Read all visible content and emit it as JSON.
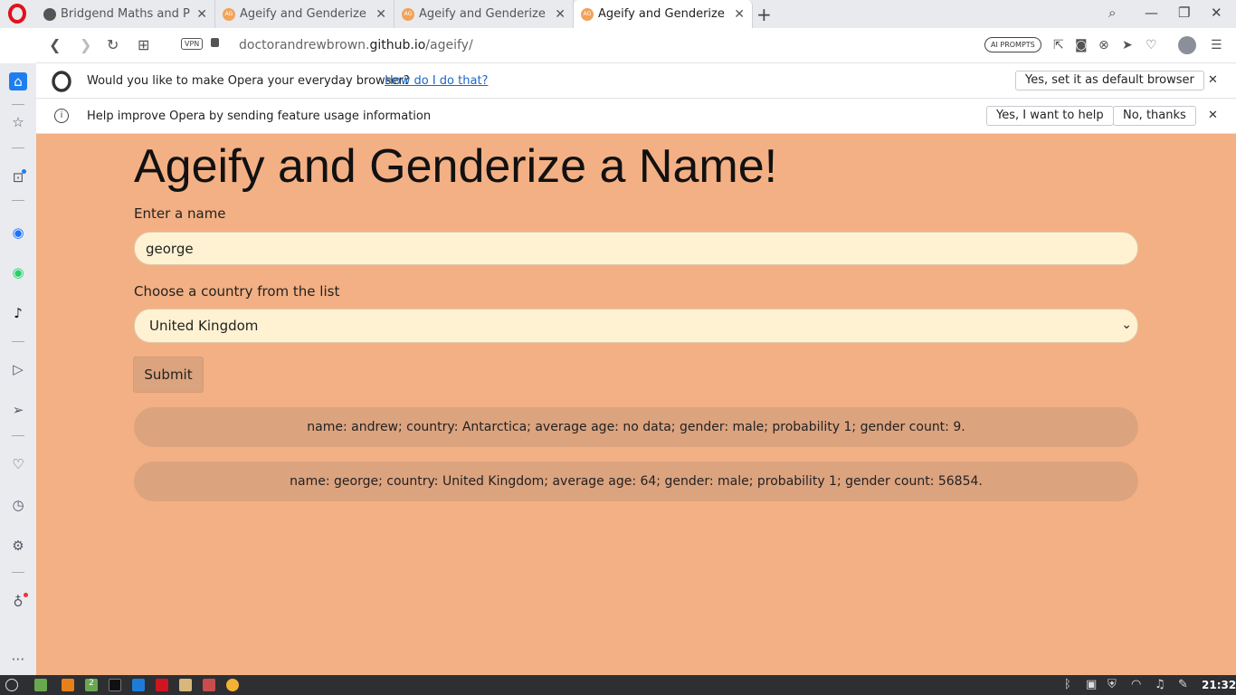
{
  "tabs": [
    {
      "title": "Bridgend Maths and Phy",
      "favicon": "github-icon"
    },
    {
      "title": "Ageify and Genderize a N",
      "favicon": "ag-icon"
    },
    {
      "title": "Ageify and Genderize a N",
      "favicon": "ag-icon"
    },
    {
      "title": "Ageify and Genderize a N",
      "favicon": "ag-icon",
      "active": true
    }
  ],
  "favicon_text": "AG",
  "address": {
    "url_host": "doctorandrewbrown.",
    "url_domain": "github.io",
    "url_path": "/ageify/",
    "vpn_label": "VPN",
    "ai_prompts_label": "AI PROMPTS"
  },
  "infobar_default": {
    "message": "Would you like to make Opera your everyday browser?",
    "link": "How do I do that?",
    "button": "Yes, set it as default browser"
  },
  "infobar_usage": {
    "message": "Help improve Opera by sending feature usage information",
    "accept": "Yes, I want to help",
    "decline": "No, thanks"
  },
  "page": {
    "heading": "Ageify and Genderize a Name!",
    "name_label": "Enter a name",
    "name_value": "george",
    "country_label": "Choose a country from the list",
    "country_value": "United Kingdom",
    "submit_label": "Submit",
    "results": [
      "name: andrew; country: Antarctica; average age: no data; gender: male; probability 1; gender count: 9.",
      "name: george; country: United Kingdom; average age: 64; gender: male; probability 1; gender count: 56854."
    ]
  },
  "taskbar": {
    "clock": "21:32",
    "workspace_badge": "2"
  },
  "colors": {
    "page_bg": "#f3b084",
    "input_bg": "#fef2d3",
    "result_bg": "#dca37f",
    "accent": "#1e7ef0"
  }
}
